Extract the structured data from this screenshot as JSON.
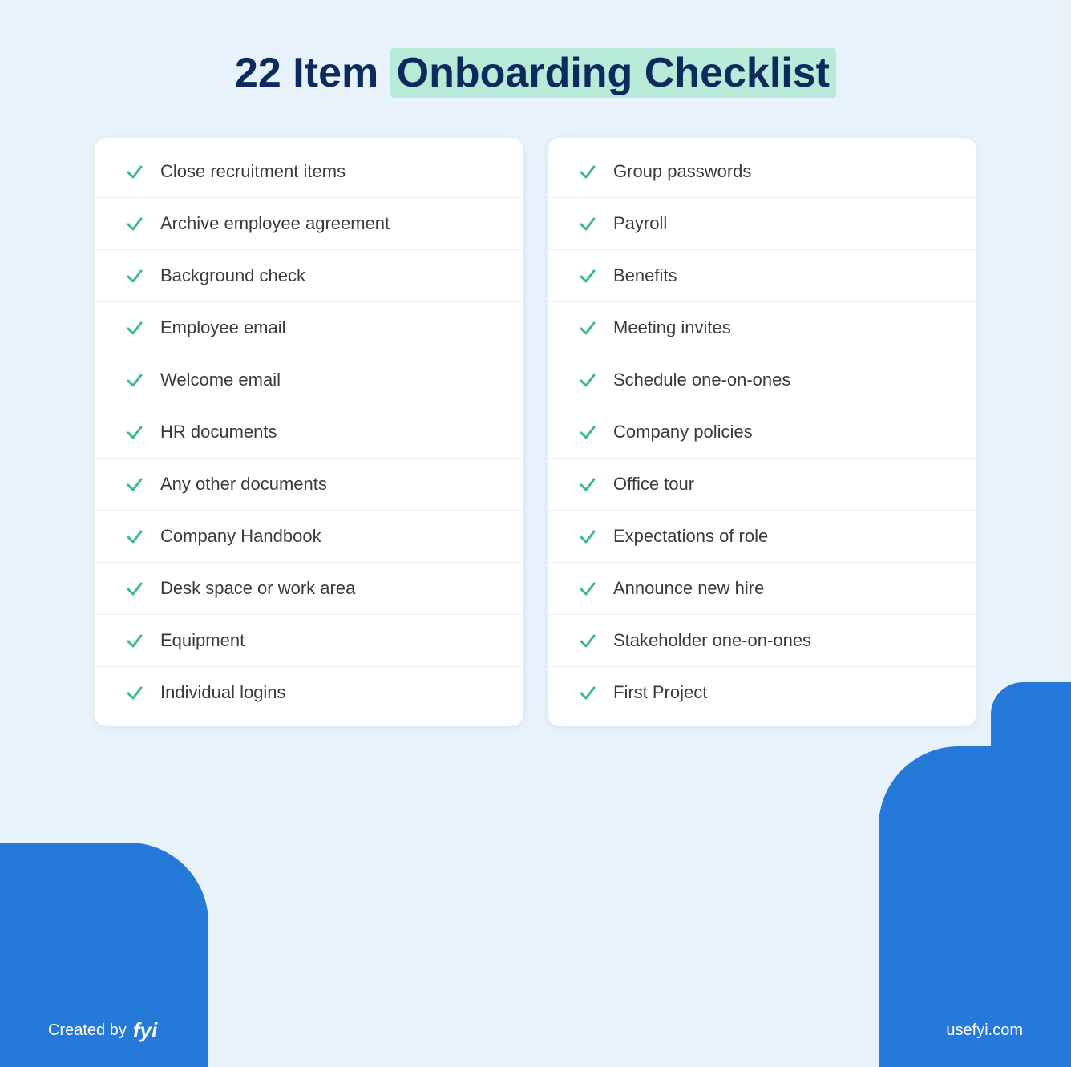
{
  "header": {
    "title_plain": "22 Item ",
    "title_highlight": "Onboarding Checklist"
  },
  "colors": {
    "blue_accent": "#2579d8",
    "highlight_bg": "#b8ead8",
    "dark_navy": "#0d2a5e",
    "check_green": "#3dba8a"
  },
  "left_column": [
    {
      "id": 1,
      "text": "Close recruitment items"
    },
    {
      "id": 2,
      "text": "Archive employee agreement"
    },
    {
      "id": 3,
      "text": "Background check"
    },
    {
      "id": 4,
      "text": "Employee email"
    },
    {
      "id": 5,
      "text": "Welcome email"
    },
    {
      "id": 6,
      "text": "HR documents"
    },
    {
      "id": 7,
      "text": "Any other documents"
    },
    {
      "id": 8,
      "text": "Company Handbook"
    },
    {
      "id": 9,
      "text": "Desk space or work area"
    },
    {
      "id": 10,
      "text": "Equipment"
    },
    {
      "id": 11,
      "text": "Individual logins"
    }
  ],
  "right_column": [
    {
      "id": 12,
      "text": "Group passwords"
    },
    {
      "id": 13,
      "text": "Payroll"
    },
    {
      "id": 14,
      "text": "Benefits"
    },
    {
      "id": 15,
      "text": "Meeting invites"
    },
    {
      "id": 16,
      "text": "Schedule one-on-ones"
    },
    {
      "id": 17,
      "text": "Company policies"
    },
    {
      "id": 18,
      "text": "Office tour"
    },
    {
      "id": 19,
      "text": "Expectations of role"
    },
    {
      "id": 20,
      "text": "Announce new hire"
    },
    {
      "id": 21,
      "text": "Stakeholder one-on-ones"
    },
    {
      "id": 22,
      "text": "First Project"
    }
  ],
  "footer": {
    "created_by_label": "Created by",
    "logo_text": "fyi",
    "url": "usefyi.com"
  }
}
